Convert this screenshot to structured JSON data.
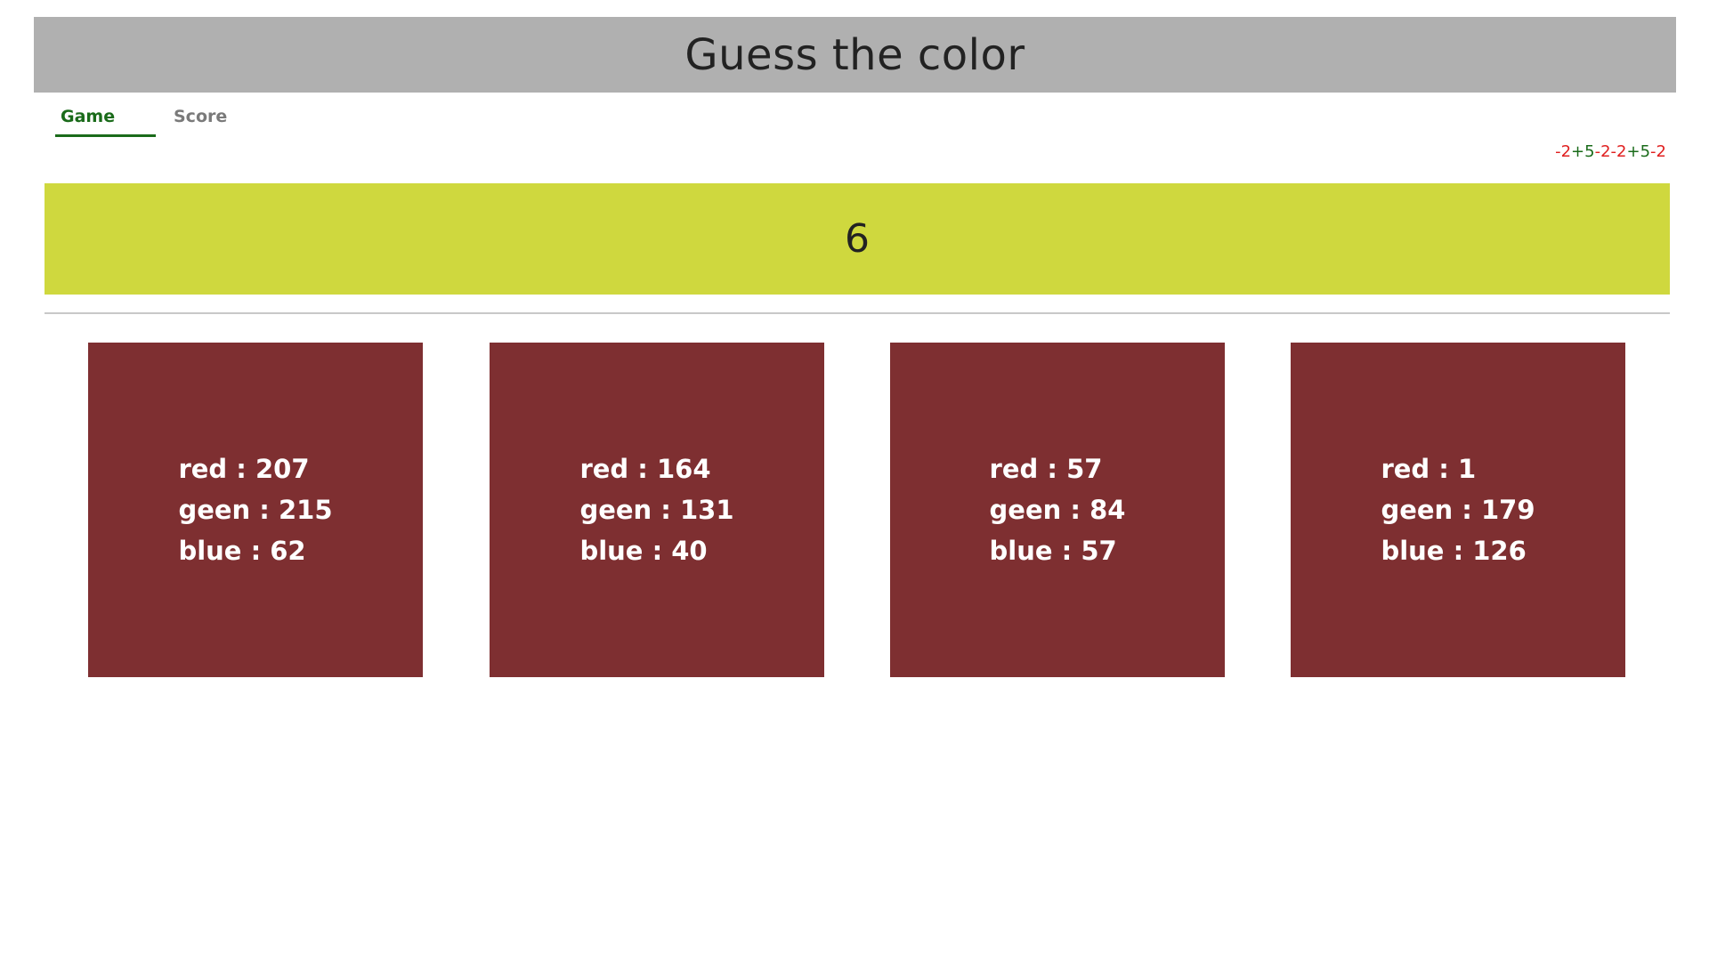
{
  "header": {
    "title": "Guess the color"
  },
  "tabs": [
    {
      "label": "Game",
      "active": true
    },
    {
      "label": "Score",
      "active": false
    }
  ],
  "history": [
    {
      "text": "-2",
      "kind": "neg"
    },
    {
      "text": "+5",
      "kind": "pos"
    },
    {
      "text": "-2",
      "kind": "neg"
    },
    {
      "text": "-2",
      "kind": "neg"
    },
    {
      "text": "+5",
      "kind": "pos"
    },
    {
      "text": "-2",
      "kind": "neg"
    }
  ],
  "target": {
    "value": "6",
    "color": "#cfd83e"
  },
  "option_color": "#7e2f31",
  "options": [
    {
      "red": "red : 207",
      "green": "geen : 215",
      "blue": "blue : 62"
    },
    {
      "red": "red : 164",
      "green": "geen : 131",
      "blue": "blue : 40"
    },
    {
      "red": "red : 57",
      "green": "geen : 84",
      "blue": "blue : 57"
    },
    {
      "red": "red : 1",
      "green": "geen : 179",
      "blue": "blue : 126"
    }
  ],
  "colors": {
    "header_bg": "#b0b0b0",
    "active_tab": "#1a6b1a",
    "inactive_tab": "#7a7a7a",
    "negative": "#e02020",
    "positive": "#1a6b1a"
  }
}
